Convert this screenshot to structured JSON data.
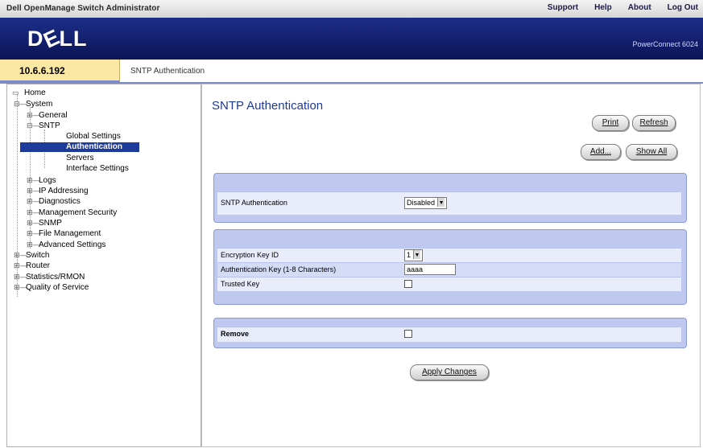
{
  "topbar": {
    "app_title": "Dell OpenManage Switch Administrator",
    "links": [
      "Support",
      "Help",
      "About",
      "Log Out"
    ]
  },
  "banner": {
    "logo": "DELL",
    "product": "PowerConnect 6024"
  },
  "ip_address": "10.6.6.192",
  "breadcrumb": "SNTP Authentication",
  "tree": {
    "home": "Home",
    "system": "System",
    "general": "General",
    "sntp": "SNTP",
    "global_settings": "Global Settings",
    "authentication": "Authentication",
    "servers": "Servers",
    "interface_settings": "Interface Settings",
    "logs": "Logs",
    "ip_addressing": "IP Addressing",
    "diagnostics": "Diagnostics",
    "management_security": "Management Security",
    "snmp": "SNMP",
    "file_management": "File Management",
    "advanced_settings": "Advanced Settings",
    "switch": "Switch",
    "router": "Router",
    "statistics_rmon": "Statistics/RMON",
    "quality_of_service": "Quality of Service"
  },
  "main": {
    "title": "SNTP Authentication",
    "print_label": "Print",
    "refresh_label": "Refresh",
    "add_label": "Add...",
    "show_all_label": "Show All",
    "sntp_auth_label": "SNTP Authentication",
    "sntp_auth_value": "Disabled",
    "key_id_label": "Encryption Key ID",
    "key_id_value": "1",
    "auth_key_label": "Authentication Key (1-8 Characters)",
    "auth_key_value": "aaaa",
    "trusted_key_label": "Trusted Key",
    "remove_label": "Remove",
    "apply_label": "Apply Changes"
  }
}
